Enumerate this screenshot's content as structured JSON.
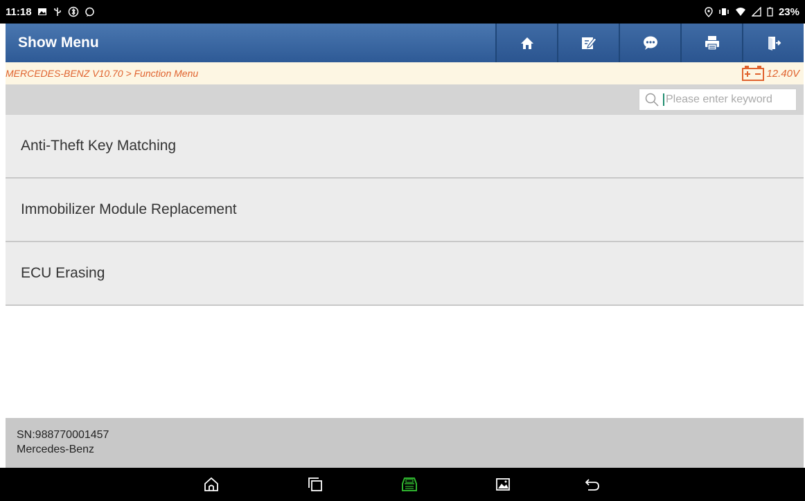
{
  "status_bar": {
    "time": "11:18",
    "battery": "23%"
  },
  "header": {
    "title": "Show Menu",
    "buttons": [
      "home-icon",
      "edit-icon",
      "message-icon",
      "print-icon",
      "exit-icon"
    ]
  },
  "breadcrumb": {
    "path": "MERCEDES-BENZ V10.70 > Function Menu",
    "voltage": "12.40V"
  },
  "search": {
    "placeholder": "Please enter keyword"
  },
  "menu": {
    "items": [
      {
        "label": "Anti-Theft Key Matching"
      },
      {
        "label": "Immobilizer Module Replacement"
      },
      {
        "label": "ECU Erasing"
      }
    ]
  },
  "footer": {
    "serial": "SN:988770001457",
    "vehicle": "Mercedes-Benz"
  },
  "nav_bar": {
    "buttons": [
      "home-icon",
      "recents-icon",
      "vci-icon",
      "gallery-icon",
      "back-icon"
    ]
  },
  "colors": {
    "title_bar": "#3a66a0",
    "breadcrumb_text": "#e0622e",
    "vci_green": "#2fb52f"
  }
}
